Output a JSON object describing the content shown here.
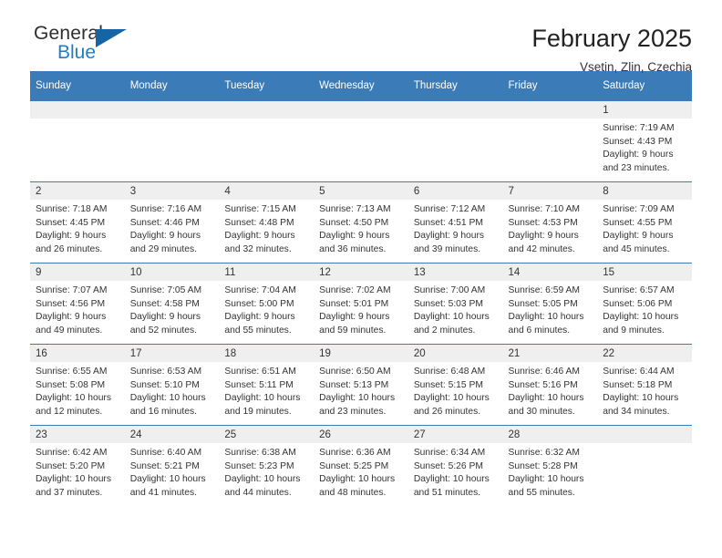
{
  "brand": {
    "name_top": "General",
    "name_bottom": "Blue",
    "triangle_color": "#1565a6",
    "blue_color": "#1f7fc4"
  },
  "header": {
    "title": "February 2025",
    "subtitle": "Vsetin, Zlin, Czechia"
  },
  "theme": {
    "header_bg": "#3b7cb8",
    "daynum_band_bg": "#efefef",
    "row_divider": "#3b7cb8",
    "text": "#333333"
  },
  "columns": [
    "Sunday",
    "Monday",
    "Tuesday",
    "Wednesday",
    "Thursday",
    "Friday",
    "Saturday"
  ],
  "labels": {
    "sunrise": "Sunrise:",
    "sunset": "Sunset:",
    "daylight": "Daylight:"
  },
  "weeks": [
    [
      {
        "day": "",
        "sunrise": "",
        "sunset": "",
        "daylight": ""
      },
      {
        "day": "",
        "sunrise": "",
        "sunset": "",
        "daylight": ""
      },
      {
        "day": "",
        "sunrise": "",
        "sunset": "",
        "daylight": ""
      },
      {
        "day": "",
        "sunrise": "",
        "sunset": "",
        "daylight": ""
      },
      {
        "day": "",
        "sunrise": "",
        "sunset": "",
        "daylight": ""
      },
      {
        "day": "",
        "sunrise": "",
        "sunset": "",
        "daylight": ""
      },
      {
        "day": "1",
        "sunrise": "Sunrise: 7:19 AM",
        "sunset": "Sunset: 4:43 PM",
        "daylight": "Daylight: 9 hours and 23 minutes."
      }
    ],
    [
      {
        "day": "2",
        "sunrise": "Sunrise: 7:18 AM",
        "sunset": "Sunset: 4:45 PM",
        "daylight": "Daylight: 9 hours and 26 minutes."
      },
      {
        "day": "3",
        "sunrise": "Sunrise: 7:16 AM",
        "sunset": "Sunset: 4:46 PM",
        "daylight": "Daylight: 9 hours and 29 minutes."
      },
      {
        "day": "4",
        "sunrise": "Sunrise: 7:15 AM",
        "sunset": "Sunset: 4:48 PM",
        "daylight": "Daylight: 9 hours and 32 minutes."
      },
      {
        "day": "5",
        "sunrise": "Sunrise: 7:13 AM",
        "sunset": "Sunset: 4:50 PM",
        "daylight": "Daylight: 9 hours and 36 minutes."
      },
      {
        "day": "6",
        "sunrise": "Sunrise: 7:12 AM",
        "sunset": "Sunset: 4:51 PM",
        "daylight": "Daylight: 9 hours and 39 minutes."
      },
      {
        "day": "7",
        "sunrise": "Sunrise: 7:10 AM",
        "sunset": "Sunset: 4:53 PM",
        "daylight": "Daylight: 9 hours and 42 minutes."
      },
      {
        "day": "8",
        "sunrise": "Sunrise: 7:09 AM",
        "sunset": "Sunset: 4:55 PM",
        "daylight": "Daylight: 9 hours and 45 minutes."
      }
    ],
    [
      {
        "day": "9",
        "sunrise": "Sunrise: 7:07 AM",
        "sunset": "Sunset: 4:56 PM",
        "daylight": "Daylight: 9 hours and 49 minutes."
      },
      {
        "day": "10",
        "sunrise": "Sunrise: 7:05 AM",
        "sunset": "Sunset: 4:58 PM",
        "daylight": "Daylight: 9 hours and 52 minutes."
      },
      {
        "day": "11",
        "sunrise": "Sunrise: 7:04 AM",
        "sunset": "Sunset: 5:00 PM",
        "daylight": "Daylight: 9 hours and 55 minutes."
      },
      {
        "day": "12",
        "sunrise": "Sunrise: 7:02 AM",
        "sunset": "Sunset: 5:01 PM",
        "daylight": "Daylight: 9 hours and 59 minutes."
      },
      {
        "day": "13",
        "sunrise": "Sunrise: 7:00 AM",
        "sunset": "Sunset: 5:03 PM",
        "daylight": "Daylight: 10 hours and 2 minutes."
      },
      {
        "day": "14",
        "sunrise": "Sunrise: 6:59 AM",
        "sunset": "Sunset: 5:05 PM",
        "daylight": "Daylight: 10 hours and 6 minutes."
      },
      {
        "day": "15",
        "sunrise": "Sunrise: 6:57 AM",
        "sunset": "Sunset: 5:06 PM",
        "daylight": "Daylight: 10 hours and 9 minutes."
      }
    ],
    [
      {
        "day": "16",
        "sunrise": "Sunrise: 6:55 AM",
        "sunset": "Sunset: 5:08 PM",
        "daylight": "Daylight: 10 hours and 12 minutes."
      },
      {
        "day": "17",
        "sunrise": "Sunrise: 6:53 AM",
        "sunset": "Sunset: 5:10 PM",
        "daylight": "Daylight: 10 hours and 16 minutes."
      },
      {
        "day": "18",
        "sunrise": "Sunrise: 6:51 AM",
        "sunset": "Sunset: 5:11 PM",
        "daylight": "Daylight: 10 hours and 19 minutes."
      },
      {
        "day": "19",
        "sunrise": "Sunrise: 6:50 AM",
        "sunset": "Sunset: 5:13 PM",
        "daylight": "Daylight: 10 hours and 23 minutes."
      },
      {
        "day": "20",
        "sunrise": "Sunrise: 6:48 AM",
        "sunset": "Sunset: 5:15 PM",
        "daylight": "Daylight: 10 hours and 26 minutes."
      },
      {
        "day": "21",
        "sunrise": "Sunrise: 6:46 AM",
        "sunset": "Sunset: 5:16 PM",
        "daylight": "Daylight: 10 hours and 30 minutes."
      },
      {
        "day": "22",
        "sunrise": "Sunrise: 6:44 AM",
        "sunset": "Sunset: 5:18 PM",
        "daylight": "Daylight: 10 hours and 34 minutes."
      }
    ],
    [
      {
        "day": "23",
        "sunrise": "Sunrise: 6:42 AM",
        "sunset": "Sunset: 5:20 PM",
        "daylight": "Daylight: 10 hours and 37 minutes."
      },
      {
        "day": "24",
        "sunrise": "Sunrise: 6:40 AM",
        "sunset": "Sunset: 5:21 PM",
        "daylight": "Daylight: 10 hours and 41 minutes."
      },
      {
        "day": "25",
        "sunrise": "Sunrise: 6:38 AM",
        "sunset": "Sunset: 5:23 PM",
        "daylight": "Daylight: 10 hours and 44 minutes."
      },
      {
        "day": "26",
        "sunrise": "Sunrise: 6:36 AM",
        "sunset": "Sunset: 5:25 PM",
        "daylight": "Daylight: 10 hours and 48 minutes."
      },
      {
        "day": "27",
        "sunrise": "Sunrise: 6:34 AM",
        "sunset": "Sunset: 5:26 PM",
        "daylight": "Daylight: 10 hours and 51 minutes."
      },
      {
        "day": "28",
        "sunrise": "Sunrise: 6:32 AM",
        "sunset": "Sunset: 5:28 PM",
        "daylight": "Daylight: 10 hours and 55 minutes."
      },
      {
        "day": "",
        "sunrise": "",
        "sunset": "",
        "daylight": ""
      }
    ]
  ]
}
